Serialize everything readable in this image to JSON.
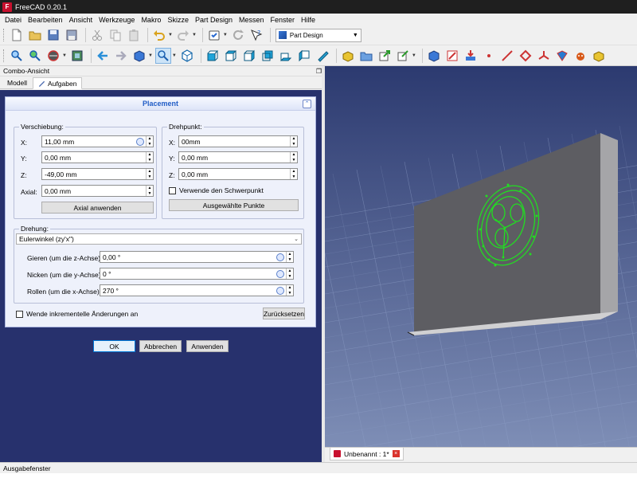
{
  "window": {
    "title": "FreeCAD 0.20.1"
  },
  "menu": [
    "Datei",
    "Bearbeiten",
    "Ansicht",
    "Werkzeuge",
    "Makro",
    "Skizze",
    "Part Design",
    "Messen",
    "Fenster",
    "Hilfe"
  ],
  "workbench_selector": {
    "value": "Part Design"
  },
  "combo_view": {
    "title": "Combo-Ansicht",
    "tabs": [
      "Modell",
      "Aufgaben"
    ],
    "active_tab": "Aufgaben"
  },
  "placement": {
    "title": "Placement",
    "translation": {
      "title": "Verschiebung:",
      "x_label": "X:",
      "x": "11,00 mm",
      "y_label": "Y:",
      "y": "0,00 mm",
      "z_label": "Z:",
      "z": "-49,00 mm",
      "axial_label": "Axial:",
      "axial": "0,00 mm",
      "apply_axial": "Axial anwenden"
    },
    "center": {
      "title": "Drehpunkt:",
      "x_label": "X:",
      "x": "00mm",
      "y_label": "Y:",
      "y": "0,00 mm",
      "z_label": "Z:",
      "z": "0,00 mm",
      "use_centroid": "Verwende den Schwerpunkt",
      "selected_points": "Ausgewählte Punkte"
    },
    "rotation": {
      "title": "Drehung:",
      "mode": "Eulerwinkel (zy'x\")",
      "yaw_label": "Gieren (um die z-Achse):",
      "yaw": "0,00 °",
      "pitch_label": "Nicken (um die y-Achse):",
      "pitch": "0 °",
      "roll_label": "Rollen (um die x-Achse):",
      "roll": "270 °"
    },
    "incremental": "Wende inkrementelle Änderungen an",
    "reset": "Zurücksetzen"
  },
  "dialog_buttons": {
    "ok": "OK",
    "cancel": "Abbrechen",
    "apply": "Anwenden"
  },
  "document_tab": {
    "label": "Unbenannt : 1*"
  },
  "report_view": {
    "title": "Ausgabefenster"
  },
  "colors": {
    "task_bg": "#27316d",
    "sketch_green": "#22dd22",
    "accent_blue": "#215dc6"
  },
  "toolbar_icons_row1": [
    "new-icon",
    "open-icon",
    "save-icon",
    "save-as-icon",
    "cut-icon",
    "copy-icon",
    "paste-icon",
    "undo-icon",
    "redo-icon",
    "macro-record-icon",
    "refresh-icon",
    "whats-this-icon"
  ],
  "toolbar_icons_row2": [
    "fit-all-icon",
    "fit-selection-icon",
    "draw-style-icon",
    "sync-view-icon",
    "back-icon",
    "forward-icon",
    "std-views-icon",
    "zoom-icon",
    "isometric-icon",
    "front-icon",
    "top-icon",
    "right-icon",
    "rear-icon",
    "bottom-icon",
    "left-icon",
    "measure-icon",
    "part-icon",
    "group-icon",
    "link-icon",
    "link-actions-icon",
    "body-icon",
    "new-sketch-icon",
    "attach-icon",
    "point-icon",
    "line-icon",
    "plane-icon",
    "lcs-icon",
    "shape-binder-icon",
    "clone-icon",
    "pad-icon"
  ]
}
